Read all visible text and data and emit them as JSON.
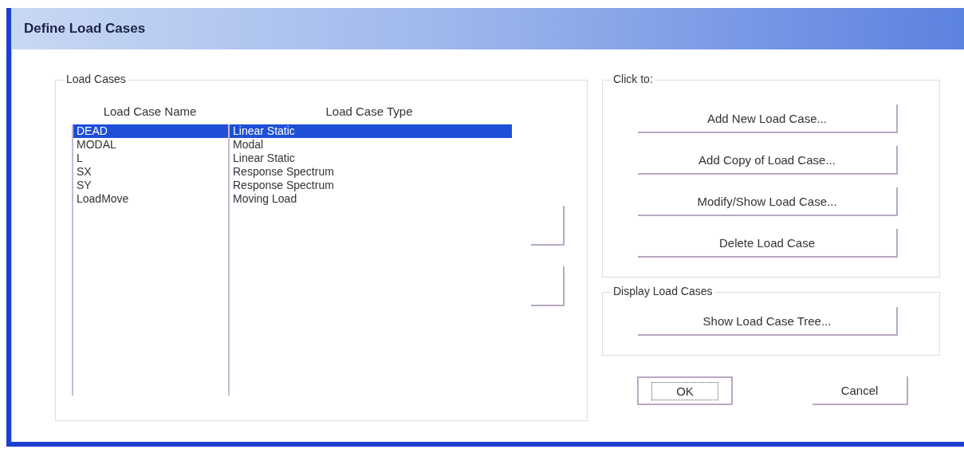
{
  "window": {
    "title": "Define Load Cases"
  },
  "load_cases": {
    "title": "Load Cases",
    "columns": [
      "Load Case Name",
      "Load Case Type"
    ],
    "rows": [
      {
        "name": "DEAD",
        "type": "Linear Static",
        "selected": true
      },
      {
        "name": "MODAL",
        "type": "Modal",
        "selected": false
      },
      {
        "name": "L",
        "type": "Linear Static",
        "selected": false
      },
      {
        "name": "SX",
        "type": "Response Spectrum",
        "selected": false
      },
      {
        "name": "SY",
        "type": "Response Spectrum",
        "selected": false
      },
      {
        "name": "LoadMove",
        "type": "Moving Load",
        "selected": false
      }
    ]
  },
  "click_to": {
    "title": "Click to:",
    "buttons": [
      "Add New Load Case...",
      "Add Copy of Load Case...",
      "Modify/Show Load Case...",
      "Delete Load Case"
    ]
  },
  "display": {
    "title": "Display Load Cases",
    "buttons": [
      "Show Load Case Tree..."
    ]
  },
  "dialog_buttons": [
    {
      "label": "OK",
      "focused": true
    },
    {
      "label": "Cancel",
      "focused": false
    }
  ]
}
